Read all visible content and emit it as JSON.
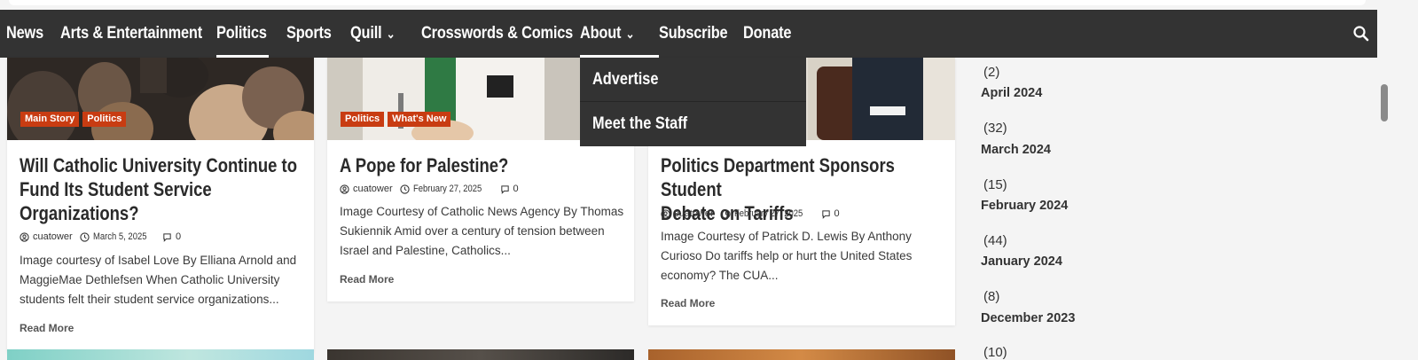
{
  "nav": {
    "items": [
      {
        "label": "News"
      },
      {
        "label": "Arts & Entertainment"
      },
      {
        "label": "Politics"
      },
      {
        "label": "Sports"
      },
      {
        "label": "Quill"
      },
      {
        "label": "Crosswords & Comics"
      },
      {
        "label": "About"
      },
      {
        "label": "Subscribe"
      },
      {
        "label": "Donate"
      }
    ],
    "dropdown": [
      "Advertise",
      "Meet the Staff"
    ]
  },
  "cards": [
    {
      "tags": [
        "Main Story",
        "Politics"
      ],
      "title_lines": [
        "Will Catholic University Continue to",
        "Fund Its Student Service",
        "Organizations?"
      ],
      "author": "cuatower",
      "date": "March 5, 2025",
      "comments": "0",
      "excerpt_lines": [
        "Image courtesy of Isabel Love  By Elliana Arnold and",
        "MaggieMae Dethlefsen When Catholic University",
        "students felt their student service organizations..."
      ],
      "read_more": "Read More"
    },
    {
      "tags": [
        "Politics",
        "What's New"
      ],
      "title_lines": [
        "A Pope for Palestine?"
      ],
      "author": "cuatower",
      "date": "February 27, 2025",
      "comments": "0",
      "excerpt_lines": [
        "Image Courtesy of Catholic News Agency By Thomas",
        "Sukiennik Amid over a century of tension between",
        "Israel and Palestine, Catholics..."
      ],
      "read_more": "Read More"
    },
    {
      "tags": [],
      "title_lines": [
        "Politics Department Sponsors Student",
        "Debate on Tariffs"
      ],
      "author": "cuatower",
      "date": "February 27, 2025",
      "comments": "0",
      "excerpt_lines": [
        "Image Courtesy of Patrick D. Lewis By Anthony",
        "Curioso Do tariffs help or hurt the United States",
        "economy? The CUA..."
      ],
      "read_more": "Read More"
    }
  ],
  "archives": [
    {
      "count": "(2)",
      "month": "April 2024"
    },
    {
      "count": "(32)",
      "month": "March 2024"
    },
    {
      "count": "(15)",
      "month": "February 2024"
    },
    {
      "count": "(44)",
      "month": "January 2024"
    },
    {
      "count": "(8)",
      "month": "December 2023"
    },
    {
      "count": "(10)",
      "month": ""
    }
  ],
  "colors": {
    "navbar": "#333333",
    "tag": "#c83c12",
    "page_bg": "#f4f4f4"
  }
}
